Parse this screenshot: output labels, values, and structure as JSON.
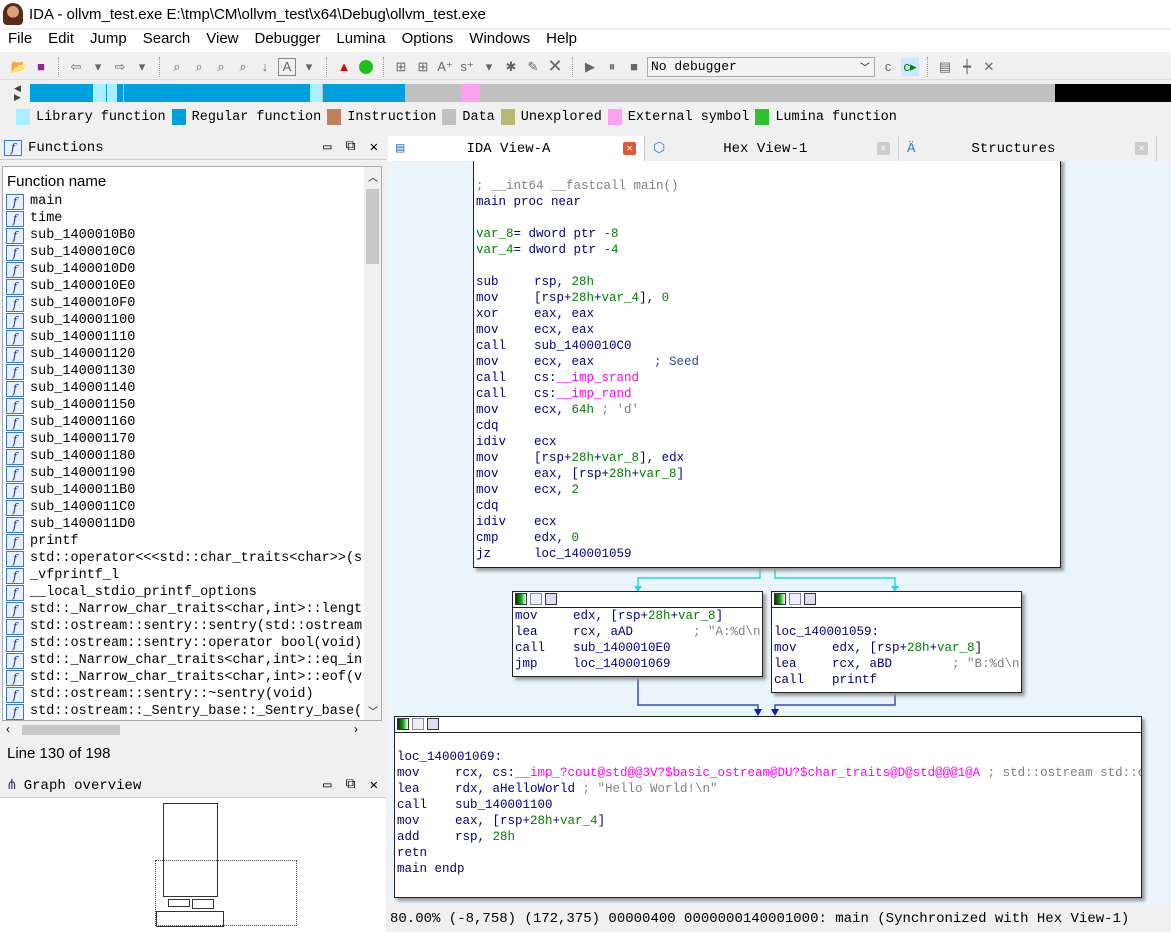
{
  "title": "IDA - ollvm_test.exe E:\\tmp\\CM\\ollvm_test\\x64\\Debug\\ollvm_test.exe",
  "menu": [
    "File",
    "Edit",
    "Jump",
    "Search",
    "View",
    "Debugger",
    "Lumina",
    "Options",
    "Windows",
    "Help"
  ],
  "toolbar": {
    "debugger_select": "No debugger"
  },
  "legend": [
    {
      "label": "Library function",
      "color": "#a8f0ff"
    },
    {
      "label": "Regular function",
      "color": "#00a0e0"
    },
    {
      "label": "Instruction",
      "color": "#c08060"
    },
    {
      "label": "Data",
      "color": "#c0c0c0"
    },
    {
      "label": "Unexplored",
      "color": "#b8b870"
    },
    {
      "label": "External symbol",
      "color": "#ffa0f0"
    },
    {
      "label": "Lumina function",
      "color": "#30c030"
    }
  ],
  "functions_panel": {
    "title": "Functions",
    "column": "Function name",
    "line_status": "Line 130 of 198",
    "items": [
      "main",
      "time",
      "sub_1400010B0",
      "sub_1400010C0",
      "sub_1400010D0",
      "sub_1400010E0",
      "sub_1400010F0",
      "sub_140001100",
      "sub_140001110",
      "sub_140001120",
      "sub_140001130",
      "sub_140001140",
      "sub_140001150",
      "sub_140001160",
      "sub_140001170",
      "sub_140001180",
      "sub_140001190",
      "sub_1400011B0",
      "sub_1400011C0",
      "sub_1400011D0",
      "printf",
      "std::operator<<<std::char_traits<char>>(s",
      "_vfprintf_l",
      "__local_stdio_printf_options",
      "std::_Narrow_char_traits<char,int>::lengt",
      "std::ostream::sentry::sentry(std::ostream",
      "std::ostream::sentry::operator bool(void)",
      "std::_Narrow_char_traits<char,int>::eq_in",
      "std::_Narrow_char_traits<char,int>::eof(v",
      "std::ostream::sentry::~sentry(void)",
      "std::ostream::_Sentry_base::_Sentry_base("
    ]
  },
  "overview_panel": {
    "title": "Graph overview"
  },
  "tabs": [
    {
      "label": "IDA View-A"
    },
    {
      "label": "Hex View-1"
    },
    {
      "label": "Structures"
    }
  ],
  "blocks": {
    "main": [
      [
        [
          "; __int64 __fastcall main()",
          "c"
        ]
      ],
      [
        [
          "main proc near",
          "o"
        ]
      ],
      [],
      [
        [
          "var_8",
          "n"
        ],
        [
          "= dword ptr ",
          "o"
        ],
        [
          "-8",
          "n"
        ]
      ],
      [
        [
          "var_4",
          "n"
        ],
        [
          "= dword ptr ",
          "o"
        ],
        [
          "-4",
          "n"
        ]
      ],
      [],
      [
        [
          "sub",
          "mn"
        ],
        [
          "rsp, ",
          "o"
        ],
        [
          "28h",
          "n"
        ]
      ],
      [
        [
          "mov",
          "mn"
        ],
        [
          "[rsp+",
          "o"
        ],
        [
          "28h",
          "n"
        ],
        [
          "+",
          "o"
        ],
        [
          "var_4",
          "n"
        ],
        [
          "], ",
          "o"
        ],
        [
          "0",
          "n"
        ]
      ],
      [
        [
          "xor",
          "mn"
        ],
        [
          "eax, eax",
          "o"
        ]
      ],
      [
        [
          "mov",
          "mn"
        ],
        [
          "ecx, eax",
          "o"
        ]
      ],
      [
        [
          "call",
          "mn"
        ],
        [
          "sub_1400010C0",
          "o"
        ]
      ],
      [
        [
          "mov",
          "mn"
        ],
        [
          "ecx, eax        ",
          "o"
        ],
        [
          "; Seed",
          "cb"
        ]
      ],
      [
        [
          "call",
          "mn"
        ],
        [
          "cs:",
          "o"
        ],
        [
          "__imp_srand",
          "m"
        ]
      ],
      [
        [
          "call",
          "mn"
        ],
        [
          "cs:",
          "o"
        ],
        [
          "__imp_rand",
          "m"
        ]
      ],
      [
        [
          "mov",
          "mn"
        ],
        [
          "ecx, ",
          "o"
        ],
        [
          "64h",
          "n"
        ],
        [
          " ; 'd'",
          "c"
        ]
      ],
      [
        [
          "cdq",
          "mn"
        ]
      ],
      [
        [
          "idiv",
          "mn"
        ],
        [
          "ecx",
          "o"
        ]
      ],
      [
        [
          "mov",
          "mn"
        ],
        [
          "[rsp+",
          "o"
        ],
        [
          "28h",
          "n"
        ],
        [
          "+",
          "o"
        ],
        [
          "var_8",
          "n"
        ],
        [
          "], edx",
          "o"
        ]
      ],
      [
        [
          "mov",
          "mn"
        ],
        [
          "eax, [rsp+",
          "o"
        ],
        [
          "28h",
          "n"
        ],
        [
          "+",
          "o"
        ],
        [
          "var_8",
          "n"
        ],
        [
          "]",
          "o"
        ]
      ],
      [
        [
          "mov",
          "mn"
        ],
        [
          "ecx, ",
          "o"
        ],
        [
          "2",
          "n"
        ]
      ],
      [
        [
          "cdq",
          "mn"
        ]
      ],
      [
        [
          "idiv",
          "mn"
        ],
        [
          "ecx",
          "o"
        ]
      ],
      [
        [
          "cmp",
          "mn"
        ],
        [
          "edx, ",
          "o"
        ],
        [
          "0",
          "n"
        ]
      ],
      [
        [
          "jz",
          "mn"
        ],
        [
          "loc_140001059",
          "o"
        ]
      ]
    ],
    "left": [
      [
        [
          "mov",
          "mn"
        ],
        [
          "edx, [rsp+",
          "o"
        ],
        [
          "28h",
          "n"
        ],
        [
          "+",
          "o"
        ],
        [
          "var_8",
          "n"
        ],
        [
          "]",
          "o"
        ]
      ],
      [
        [
          "lea",
          "mn"
        ],
        [
          "rcx, aAD        ",
          "o"
        ],
        [
          "; \"A:%d\\n\"",
          "c"
        ]
      ],
      [
        [
          "call",
          "mn"
        ],
        [
          "sub_1400010E0",
          "o"
        ]
      ],
      [
        [
          "jmp",
          "mn"
        ],
        [
          "loc_140001069",
          "o"
        ]
      ]
    ],
    "right": [
      [],
      [
        [
          "loc_140001059:",
          "o"
        ]
      ],
      [
        [
          "mov",
          "mn"
        ],
        [
          "edx, [rsp+",
          "o"
        ],
        [
          "28h",
          "n"
        ],
        [
          "+",
          "o"
        ],
        [
          "var_8",
          "n"
        ],
        [
          "]",
          "o"
        ]
      ],
      [
        [
          "lea",
          "mn"
        ],
        [
          "rcx, aBD        ",
          "o"
        ],
        [
          "; \"B:%d\\n\"",
          "c"
        ]
      ],
      [
        [
          "call",
          "mn"
        ],
        [
          "printf",
          "o"
        ]
      ]
    ],
    "bottom": [
      [],
      [
        [
          "loc_140001069:",
          "o"
        ]
      ],
      [
        [
          "mov",
          "mn"
        ],
        [
          "rcx, cs:",
          "o"
        ],
        [
          "__imp_?cout@std@@3V?$basic_ostream@DU?$char_traits@D@std@@@1@A",
          "m"
        ],
        [
          " ; std::ostream std::cout",
          "c"
        ]
      ],
      [
        [
          "lea",
          "mn"
        ],
        [
          "rdx, aHelloWorld ",
          "o"
        ],
        [
          "; \"Hello World!\\n\"",
          "c"
        ]
      ],
      [
        [
          "call",
          "mn"
        ],
        [
          "sub_140001100",
          "o"
        ]
      ],
      [
        [
          "mov",
          "mn"
        ],
        [
          "eax, [rsp+",
          "o"
        ],
        [
          "28h",
          "n"
        ],
        [
          "+",
          "o"
        ],
        [
          "var_4",
          "n"
        ],
        [
          "]",
          "o"
        ]
      ],
      [
        [
          "add",
          "mn"
        ],
        [
          "rsp, ",
          "o"
        ],
        [
          "28h",
          "n"
        ]
      ],
      [
        [
          "retn",
          "mn"
        ]
      ],
      [
        [
          "main endp",
          "o"
        ]
      ]
    ]
  },
  "status": "80.00% (-8,758) (172,375) 00000400 0000000140001000: main (Synchronized with Hex View-1)"
}
